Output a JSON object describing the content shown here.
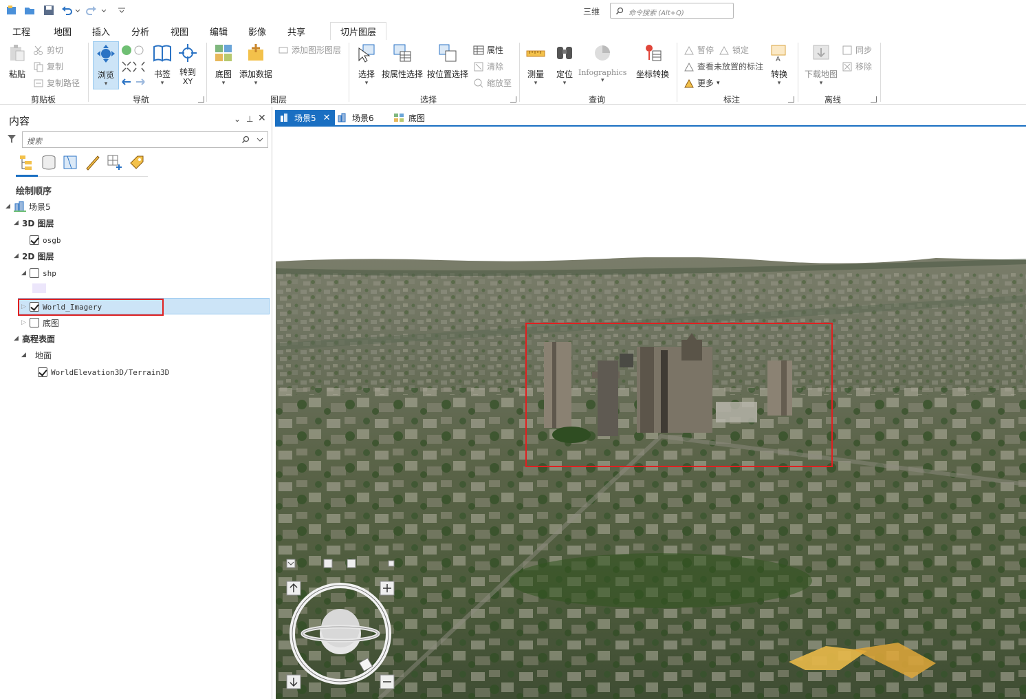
{
  "app": {
    "mode_label": "三维",
    "command_search_placeholder": "命令搜索 (Alt+Q)"
  },
  "ribbon_tabs": [
    {
      "label": "工程"
    },
    {
      "label": "地图"
    },
    {
      "label": "插入"
    },
    {
      "label": "分析"
    },
    {
      "label": "视图"
    },
    {
      "label": "编辑"
    },
    {
      "label": "影像"
    },
    {
      "label": "共享"
    },
    {
      "label": "切片图层"
    }
  ],
  "ribbon": {
    "clipboard": {
      "paste": "粘贴",
      "cut": "剪切",
      "copy": "复制",
      "copy_path": "复制路径",
      "label": "剪贴板"
    },
    "navigate": {
      "explore": "浏览",
      "bookmarks": "书签",
      "goto_xy": "转到\nXY",
      "goto": "转到",
      "xy": "XY",
      "label": "导航"
    },
    "layer": {
      "basemap": "底图",
      "add_data": "添加数据",
      "add_graphics": "添加图形图层",
      "label": "图层"
    },
    "selection": {
      "select": "选择",
      "by_attr": "按属性选择",
      "by_loc": "按位置选择",
      "attributes": "属性",
      "clear": "清除",
      "zoom_to": "缩放至",
      "label": "选择"
    },
    "inquiry": {
      "measure": "测量",
      "locate": "定位",
      "infographics": "Infographics",
      "coord_convert": "坐标转换",
      "label": "查询"
    },
    "labeling": {
      "pause": "暂停",
      "lock": "锁定",
      "view_unplaced": "查看未放置的标注",
      "more": "更多",
      "convert": "转换",
      "label": "标注"
    },
    "offline": {
      "download": "下载地图",
      "sync": "同步",
      "remove": "移除",
      "label": "离线"
    }
  },
  "contents": {
    "title": "内容",
    "search_placeholder": "搜索",
    "draw_order": "绘制顺序",
    "tree": {
      "scene": "场景5",
      "group_3d": "3D  图层",
      "osgb": "osgb",
      "group_2d": "2D  图层",
      "shp": "shp",
      "world_imagery": "World_Imagery",
      "basemap": "底图",
      "elevation": "高程表面",
      "ground": "地面",
      "terrain": "WorldElevation3D/Terrain3D"
    }
  },
  "map_tabs": [
    {
      "label": "场景5",
      "active": true
    },
    {
      "label": "场景6",
      "active": false
    },
    {
      "label": "底图",
      "active": false
    }
  ],
  "colors": {
    "accent": "#1a6fc2",
    "highlight_red": "#e02020",
    "selection": "#cce4f7"
  }
}
